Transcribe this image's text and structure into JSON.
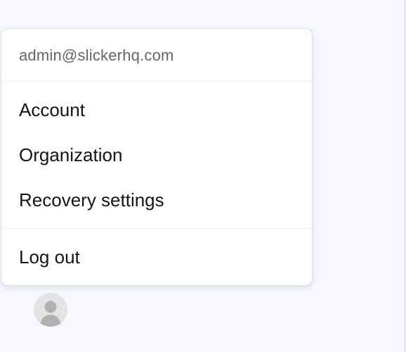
{
  "user_menu": {
    "email": "admin@slickerhq.com",
    "items": [
      {
        "label": "Account"
      },
      {
        "label": "Organization"
      },
      {
        "label": "Recovery settings"
      }
    ],
    "logout_label": "Log out"
  },
  "avatar": {
    "icon": "user-silhouette-icon"
  },
  "colors": {
    "background": "#f7f7fd",
    "menu_background": "#ffffff",
    "menu_border": "#dcdff0",
    "email_text": "#666666",
    "item_text": "#151515",
    "avatar_background": "#e3e3e3",
    "avatar_figure": "#b1b1b1"
  }
}
